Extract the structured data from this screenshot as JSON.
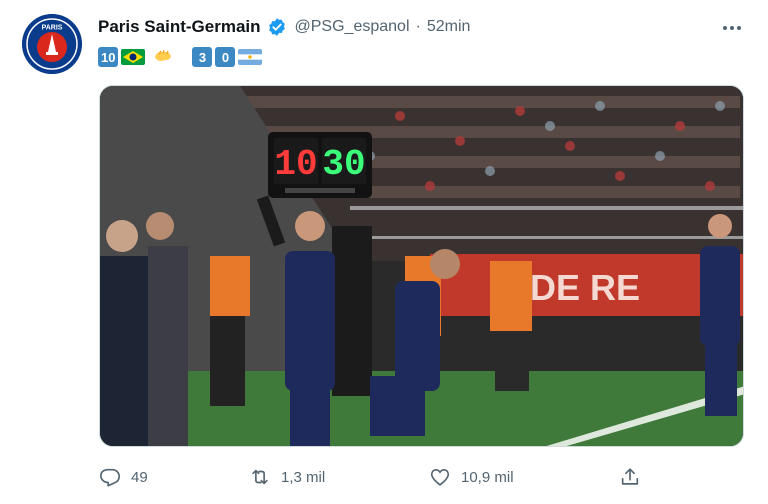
{
  "author": {
    "name": "Paris Saint-Germain",
    "handle": "@PSG_espanol",
    "separator": "·",
    "time": "52min",
    "avatar_text": "PARIS",
    "verified_icon": "verified-badge-icon"
  },
  "tweet": {
    "emoji_line": {
      "left_keycaps": [
        "10"
      ],
      "right_keycaps": [
        "3",
        "0"
      ],
      "flags": [
        "brazil-flag",
        "argentina-flag"
      ],
      "emoji": "hand-wave-emoji"
    }
  },
  "media": {
    "board_numbers": {
      "out": "10",
      "in": "30"
    },
    "banner_text": "DE  RE",
    "description_icon": "photo-substitution-board"
  },
  "actions": {
    "reply": {
      "icon": "reply-icon",
      "count": "49"
    },
    "retweet": {
      "icon": "retweet-icon",
      "count": "1,3 mil"
    },
    "like": {
      "icon": "heart-icon",
      "count": "10,9 mil"
    },
    "share": {
      "icon": "share-icon"
    }
  },
  "colors": {
    "brand_blue": "#1d9bf0",
    "text_secondary": "#536471",
    "psg_navy": "#0b3c8c",
    "psg_red": "#da291c"
  }
}
